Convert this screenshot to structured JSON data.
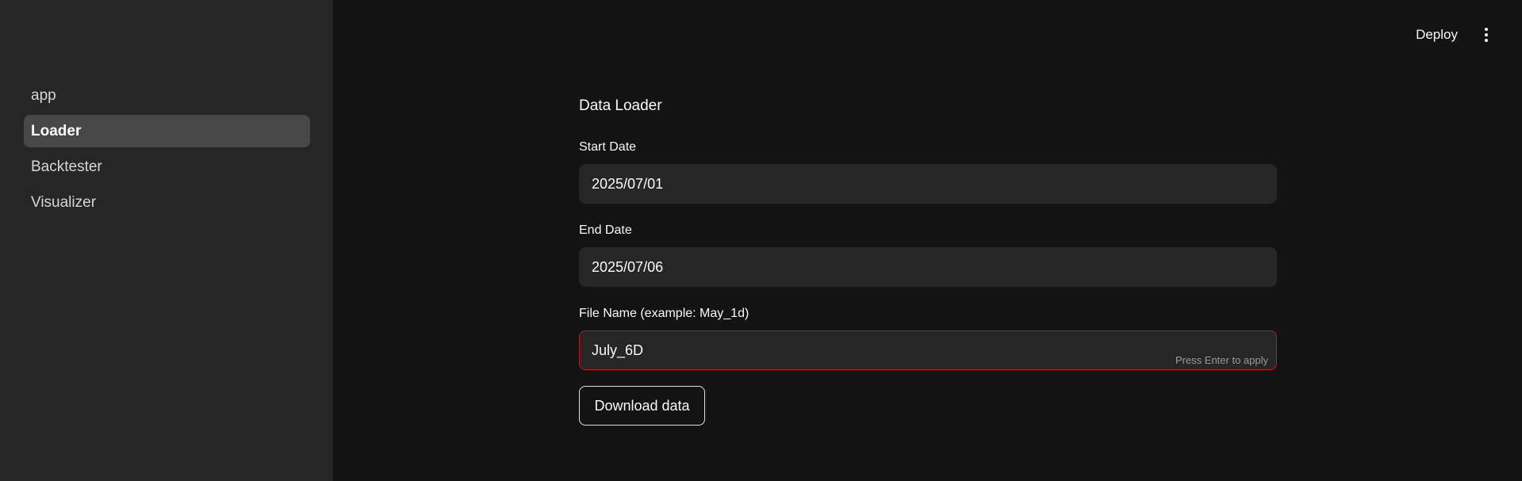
{
  "sidebar": {
    "items": [
      {
        "label": "app",
        "active": false
      },
      {
        "label": "Loader",
        "active": true
      },
      {
        "label": "Backtester",
        "active": false
      },
      {
        "label": "Visualizer",
        "active": false
      }
    ]
  },
  "header": {
    "deploy_label": "Deploy",
    "menu_icon": "vertical-ellipsis-icon"
  },
  "main": {
    "title": "Data Loader",
    "start_date": {
      "label": "Start Date",
      "value": "2025/07/01"
    },
    "end_date": {
      "label": "End Date",
      "value": "2025/07/06"
    },
    "file_name": {
      "label": "File Name (example: May_1d)",
      "value": "July_6D",
      "hint": "Press Enter to apply"
    },
    "download_label": "Download data"
  },
  "colors": {
    "background": "#131313",
    "sidebar": "#262626",
    "active_nav": "#484848",
    "focus_border": "#c5161c"
  }
}
